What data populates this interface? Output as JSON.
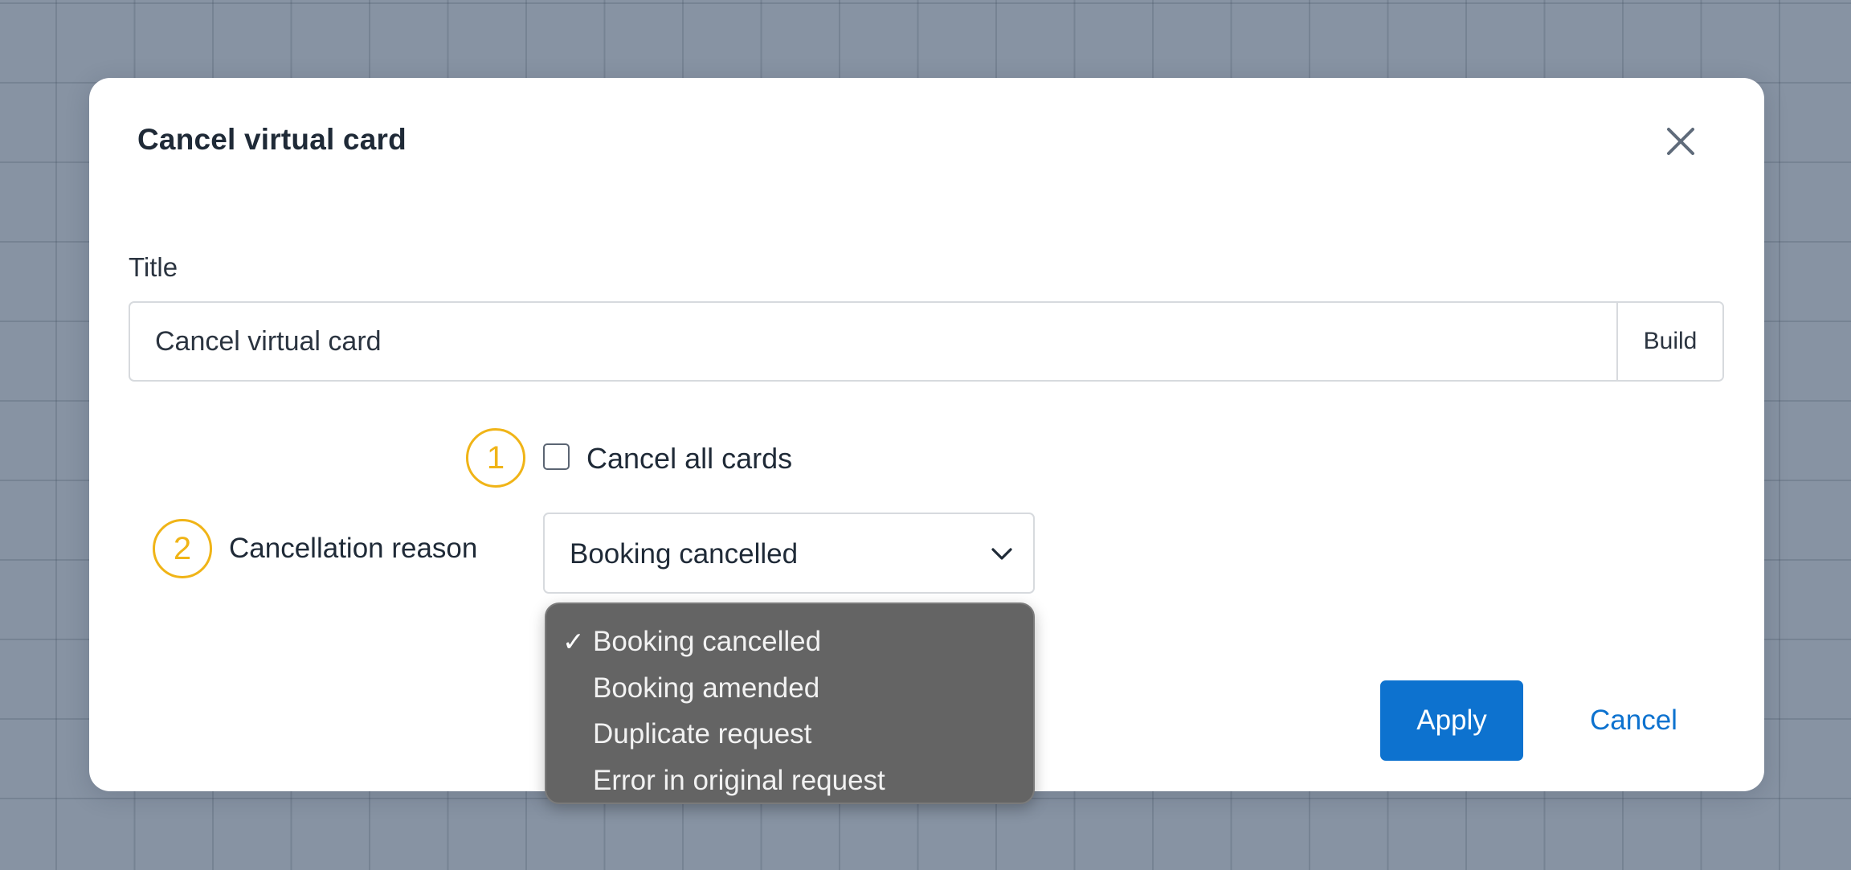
{
  "modal": {
    "title": "Cancel virtual card",
    "close_icon": "close-icon"
  },
  "title_field": {
    "label": "Title",
    "value": "Cancel virtual card",
    "build_label": "Build"
  },
  "badges": {
    "one": "1",
    "two": "2",
    "color": "#f0b417"
  },
  "cancel_all": {
    "label": "Cancel all cards",
    "checked": false
  },
  "reason": {
    "label": "Cancellation reason",
    "selected": "Booking cancelled",
    "chevron_icon": "chevron-down-icon",
    "options": [
      {
        "label": "Booking cancelled",
        "checked": true
      },
      {
        "label": "Booking amended",
        "checked": false
      },
      {
        "label": "Duplicate request",
        "checked": false
      },
      {
        "label": "Error in original request",
        "checked": false
      }
    ],
    "check_glyph": "✓"
  },
  "actions": {
    "apply_label": "Apply",
    "cancel_label": "Cancel",
    "accent": "#0d72cf"
  }
}
